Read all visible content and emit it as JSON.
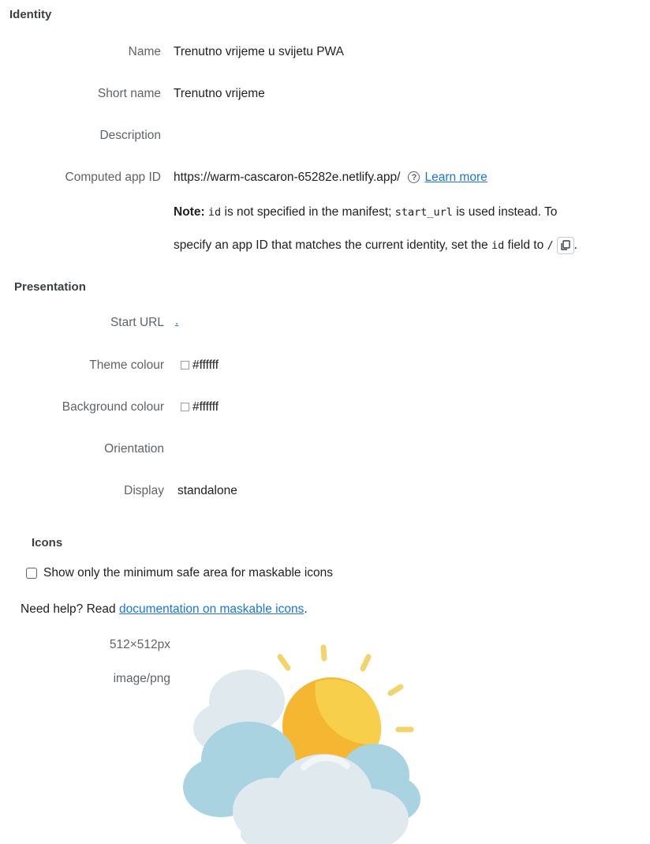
{
  "identity": {
    "heading": "Identity",
    "name_label": "Name",
    "name_value": "Trenutno vrijeme u svijetu PWA",
    "short_name_label": "Short name",
    "short_name_value": "Trenutno vrijeme",
    "description_label": "Description",
    "app_id_label": "Computed app ID",
    "app_id_value": "https://warm-cascaron-65282e.netlify.app/",
    "learn_more": "Learn more",
    "note_bold": "Note:",
    "note_code_id": "id",
    "note_text_1": "is not specified in the manifest;",
    "note_code_start_url": "start_url",
    "note_text_2": "is used instead. To",
    "note_line2_text": "specify an app ID that matches the current identity, set the",
    "note_line2_code_id": "id",
    "note_line2_text2": "field to",
    "note_line2_code_slash": "/",
    "note_line2_end": "."
  },
  "presentation": {
    "heading": "Presentation",
    "start_url_label": "Start URL",
    "start_url_value": ".",
    "theme_colour_label": "Theme colour",
    "theme_colour_value": "#ffffff",
    "background_colour_label": "Background colour",
    "background_colour_value": "#ffffff",
    "orientation_label": "Orientation",
    "display_label": "Display",
    "display_value": "standalone"
  },
  "icons": {
    "heading": "Icons",
    "checkbox_label": "Show only the minimum safe area for maskable icons",
    "help_text": "Need help? Read",
    "help_link": "documentation on maskable icons",
    "help_end": ".",
    "icon_size": "512×512px",
    "icon_type": "image/png"
  },
  "colors": {
    "link": "#1a73e8",
    "sun": "#f5b731",
    "cloud_blue": "#a9d3e0",
    "cloud_light": "#dfe9ee"
  }
}
